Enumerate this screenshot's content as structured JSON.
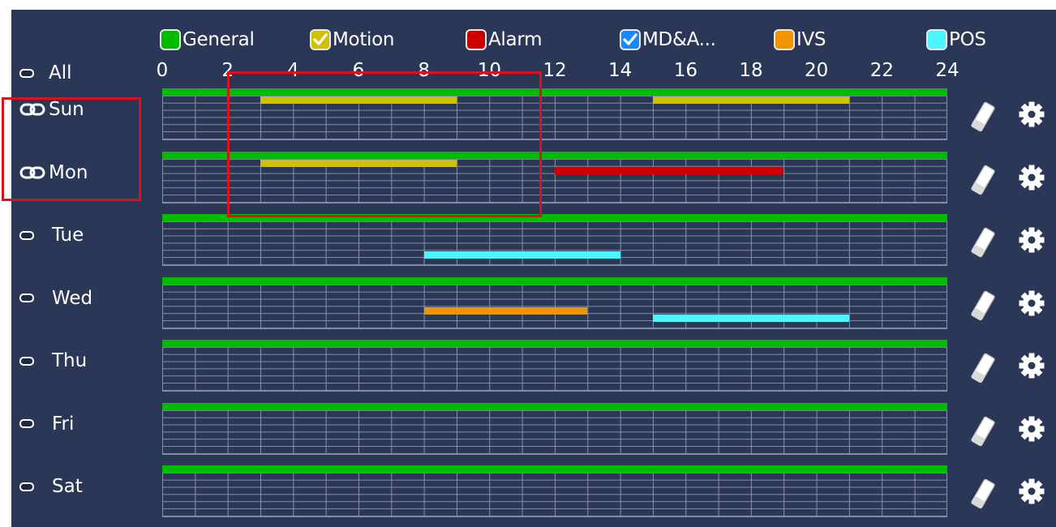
{
  "legend": [
    {
      "label": "General",
      "color": "#00bb00",
      "checked": false
    },
    {
      "label": "Motion",
      "color": "#cfc000",
      "checked": true
    },
    {
      "label": "Alarm",
      "color": "#cc0000",
      "checked": false
    },
    {
      "label": "MD&A...",
      "color": "#1a88ff",
      "checked": true
    },
    {
      "label": "IVS",
      "color": "#f29400",
      "checked": false
    },
    {
      "label": "POS",
      "color": "#4ef5ff",
      "checked": false
    }
  ],
  "all_label": "All",
  "hour_ticks": [
    "0",
    "2",
    "4",
    "6",
    "8",
    "10",
    "12",
    "14",
    "16",
    "18",
    "20",
    "22",
    "24"
  ],
  "rows": [
    {
      "day": "Sun",
      "linked": true,
      "segments": [
        {
          "type": "General",
          "start": 0,
          "end": 24
        },
        {
          "type": "Motion",
          "start": 3,
          "end": 9
        },
        {
          "type": "Motion",
          "start": 15,
          "end": 21
        }
      ]
    },
    {
      "day": "Mon",
      "linked": true,
      "segments": [
        {
          "type": "General",
          "start": 0,
          "end": 24
        },
        {
          "type": "Motion",
          "start": 3,
          "end": 9
        },
        {
          "type": "Alarm",
          "start": 12,
          "end": 19
        }
      ]
    },
    {
      "day": "Tue",
      "linked": false,
      "segments": [
        {
          "type": "General",
          "start": 0,
          "end": 24
        },
        {
          "type": "POS",
          "start": 8,
          "end": 14
        }
      ]
    },
    {
      "day": "Wed",
      "linked": false,
      "segments": [
        {
          "type": "General",
          "start": 0,
          "end": 24
        },
        {
          "type": "IVS",
          "start": 8,
          "end": 13
        },
        {
          "type": "POS",
          "start": 15,
          "end": 21
        }
      ]
    },
    {
      "day": "Thu",
      "linked": false,
      "segments": [
        {
          "type": "General",
          "start": 0,
          "end": 24
        }
      ]
    },
    {
      "day": "Fri",
      "linked": false,
      "segments": [
        {
          "type": "General",
          "start": 0,
          "end": 24
        }
      ]
    },
    {
      "day": "Sat",
      "linked": false,
      "segments": [
        {
          "type": "General",
          "start": 0,
          "end": 24
        }
      ]
    }
  ],
  "icons": {
    "row_clear": "eraser-icon",
    "row_settings": "gear-icon",
    "link": "link-icon"
  },
  "colors": {
    "background": "#2b3757",
    "grid": "#8890a6",
    "annotation": "#e0101a"
  }
}
